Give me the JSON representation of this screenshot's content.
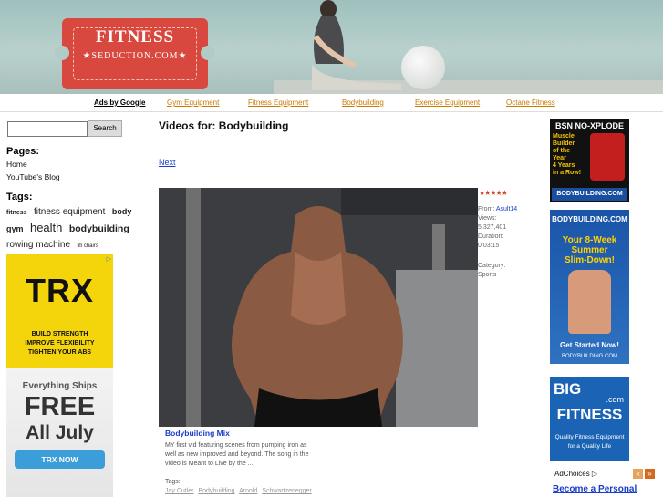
{
  "header": {
    "logo_title": "FITNESS",
    "logo_subtitle": "★SEDUCTION.COM★"
  },
  "nav": {
    "ads_label": "Ads by Google",
    "links": [
      "Gym Equipment",
      "Fitness Equipment",
      "Bodybuilding",
      "Exercise Equipment",
      "Octane Fitness"
    ]
  },
  "search": {
    "placeholder": "",
    "button_label": "Search"
  },
  "sidebar": {
    "pages_heading": "Pages:",
    "pages": [
      "Home",
      "YouTube's Blog"
    ],
    "tags_heading": "Tags:",
    "tags": [
      {
        "label": "fitness",
        "size": 7,
        "bold": true
      },
      {
        "label": "fitness equipment",
        "size": 10,
        "bold": false
      },
      {
        "label": "body",
        "size": 9,
        "bold": true
      },
      {
        "label": "gym",
        "size": 9,
        "bold": true
      },
      {
        "label": "health",
        "size": 13,
        "bold": false
      },
      {
        "label": "bodybuilding",
        "size": 11,
        "bold": true
      },
      {
        "label": "rowing machine",
        "size": 10,
        "bold": false
      },
      {
        "label": "lifi chairs",
        "size": 6,
        "bold": false
      }
    ]
  },
  "left_ad": {
    "logo": "TRX",
    "lines": [
      "BUILD STRENGTH",
      "IMPROVE FLEXIBILITY",
      "TIGHTEN YOUR ABS"
    ],
    "ships": "Everything Ships",
    "free": "FREE",
    "july": "All July",
    "cta": "TRX NOW"
  },
  "main": {
    "title": "Videos for: Bodybuilding",
    "next_label": "Next",
    "video": {
      "rating_stars": "★★★★★",
      "from_label": "From:",
      "from_user": "Asult14",
      "views_label": "Views:",
      "views": "5,327,401",
      "duration_label": "Duration:",
      "duration": "0:03:15",
      "category_label": "Category:",
      "category": "Sports",
      "title": "Bodybuilding Mix",
      "description": "MY first vid featuring scenes from pumping iron as well as new improved and beyond. The song in the video is Meant to Live by the ...",
      "tags_label": "Tags:",
      "tags": [
        "Jay Cutler",
        "Bodybuilding",
        "Arnold",
        "Schwartzenegger"
      ]
    }
  },
  "right_ads": {
    "ad1_title": "BSN NO-XPLODE",
    "ad1_lines": [
      "Muscle",
      "Builder",
      "of the",
      "Year",
      "4 Years",
      "in a Row!"
    ],
    "ad1_brand": "BODYBUILDING.COM",
    "ad2_brand": "BODYBUILDING.COM",
    "ad2_lines": [
      "Your 8-Week",
      "Summer",
      "Slim-Down!"
    ],
    "ad2_cta": "Get Started Now!",
    "ad3_big": "BIG",
    "ad3_com": ".com",
    "ad3_fitness": "FITNESS",
    "ad3_tagline": [
      "Quality Fitness Equipment",
      "for a Quality Life"
    ],
    "adchoices": "AdChoices ▷",
    "become_link": "Become a Personal"
  }
}
